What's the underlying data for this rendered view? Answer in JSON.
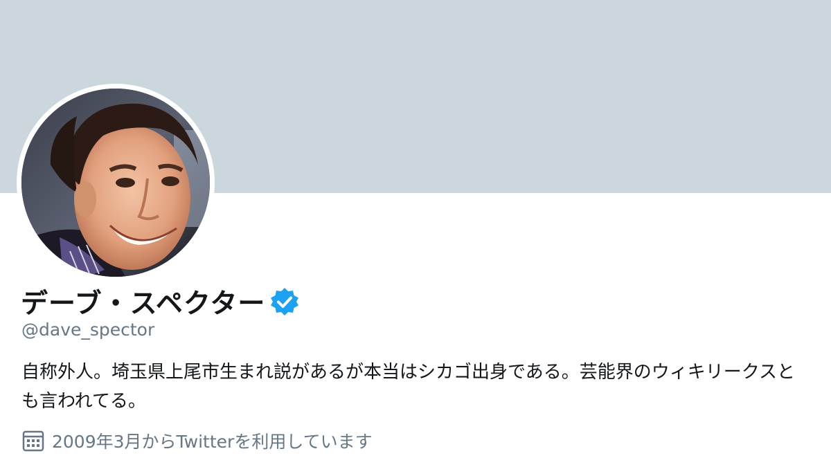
{
  "profile": {
    "display_name": "デーブ・スペクター",
    "handle": "@dave_spector",
    "verified_icon": "verified-badge-icon",
    "bio": "自称外人。埼玉県上尾市生まれ説があるが本当はシカゴ出身である。芸能界のウィキリークスとも言われてる。",
    "joined": "2009年3月からTwitterを利用しています",
    "joined_icon": "calendar-icon"
  },
  "colors": {
    "banner": "#ccd6dd",
    "name_text": "#14171a",
    "secondary_text": "#657786",
    "verified_blue": "#1da1f2"
  }
}
